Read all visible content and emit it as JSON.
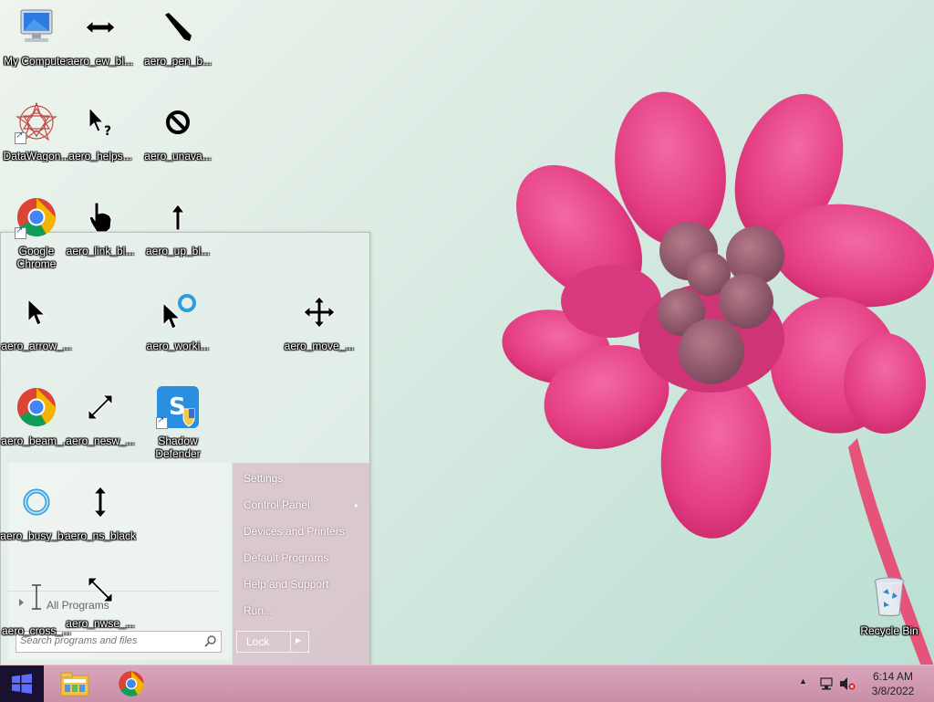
{
  "desktop": {
    "icons": [
      {
        "label": "My Computer",
        "icon": "my-computer-icon"
      },
      {
        "label": "aero_ew_bl...",
        "icon": "resize-horizontal-cursor-icon"
      },
      {
        "label": "aero_pen_b...",
        "icon": "pen-cursor-icon"
      },
      {
        "label": "DataWagon...",
        "icon": "datawagon-icon"
      },
      {
        "label": "aero_helps...",
        "icon": "help-select-cursor-icon"
      },
      {
        "label": "aero_unava...",
        "icon": "unavailable-cursor-icon"
      },
      {
        "label": "Google Chrome",
        "icon": "chrome-icon"
      },
      {
        "label": "aero_link_bl...",
        "icon": "hand-link-cursor-icon"
      },
      {
        "label": "aero_up_bl...",
        "icon": "up-arrow-cursor-icon"
      },
      {
        "label": "aero_arrow_...",
        "icon": "arrow-cursor-icon"
      },
      {
        "label": "aero_worki...",
        "icon": "working-cursor-icon"
      },
      {
        "label": "aero_move_...",
        "icon": "move-cursor-icon"
      },
      {
        "label": "aero_beam_...",
        "icon": "chrome-icon"
      },
      {
        "label": "aero_nesw_...",
        "icon": "resize-diagonal-nesw-cursor-icon"
      },
      {
        "label": "Shadow Defender",
        "icon": "shadow-defender-icon"
      },
      {
        "label": "aero_busy_b...",
        "icon": "busy-cursor-icon"
      },
      {
        "label": "aero_ns_black",
        "icon": "resize-vertical-cursor-icon"
      },
      {
        "label": "aero_cross_...",
        "icon": "text-beam-cursor-icon"
      },
      {
        "label": "aero_nwse_...",
        "icon": "resize-diagonal-nwse-cursor-icon"
      },
      {
        "label": "Recycle Bin",
        "icon": "recycle-bin-icon"
      }
    ]
  },
  "start_menu": {
    "right_items": [
      {
        "label": "Settings"
      },
      {
        "label": "Control Panel",
        "submenu": "▸"
      },
      {
        "label": "Devices and Printers"
      },
      {
        "label": "Default Programs"
      },
      {
        "label": "Help and Support"
      },
      {
        "label": "Run..."
      }
    ],
    "all_programs": "All Programs",
    "search_placeholder": "Search programs and files",
    "lock_label": "Lock"
  },
  "taskbar": {
    "apps": [
      {
        "name": "file-explorer-icon"
      },
      {
        "name": "chrome-icon"
      }
    ],
    "clock_time": "6:14 AM",
    "clock_date": "3/8/2022"
  },
  "colors": {
    "taskbar": "#d3a0b6",
    "start_button": "#1a1030",
    "flower": "#e8347e"
  }
}
